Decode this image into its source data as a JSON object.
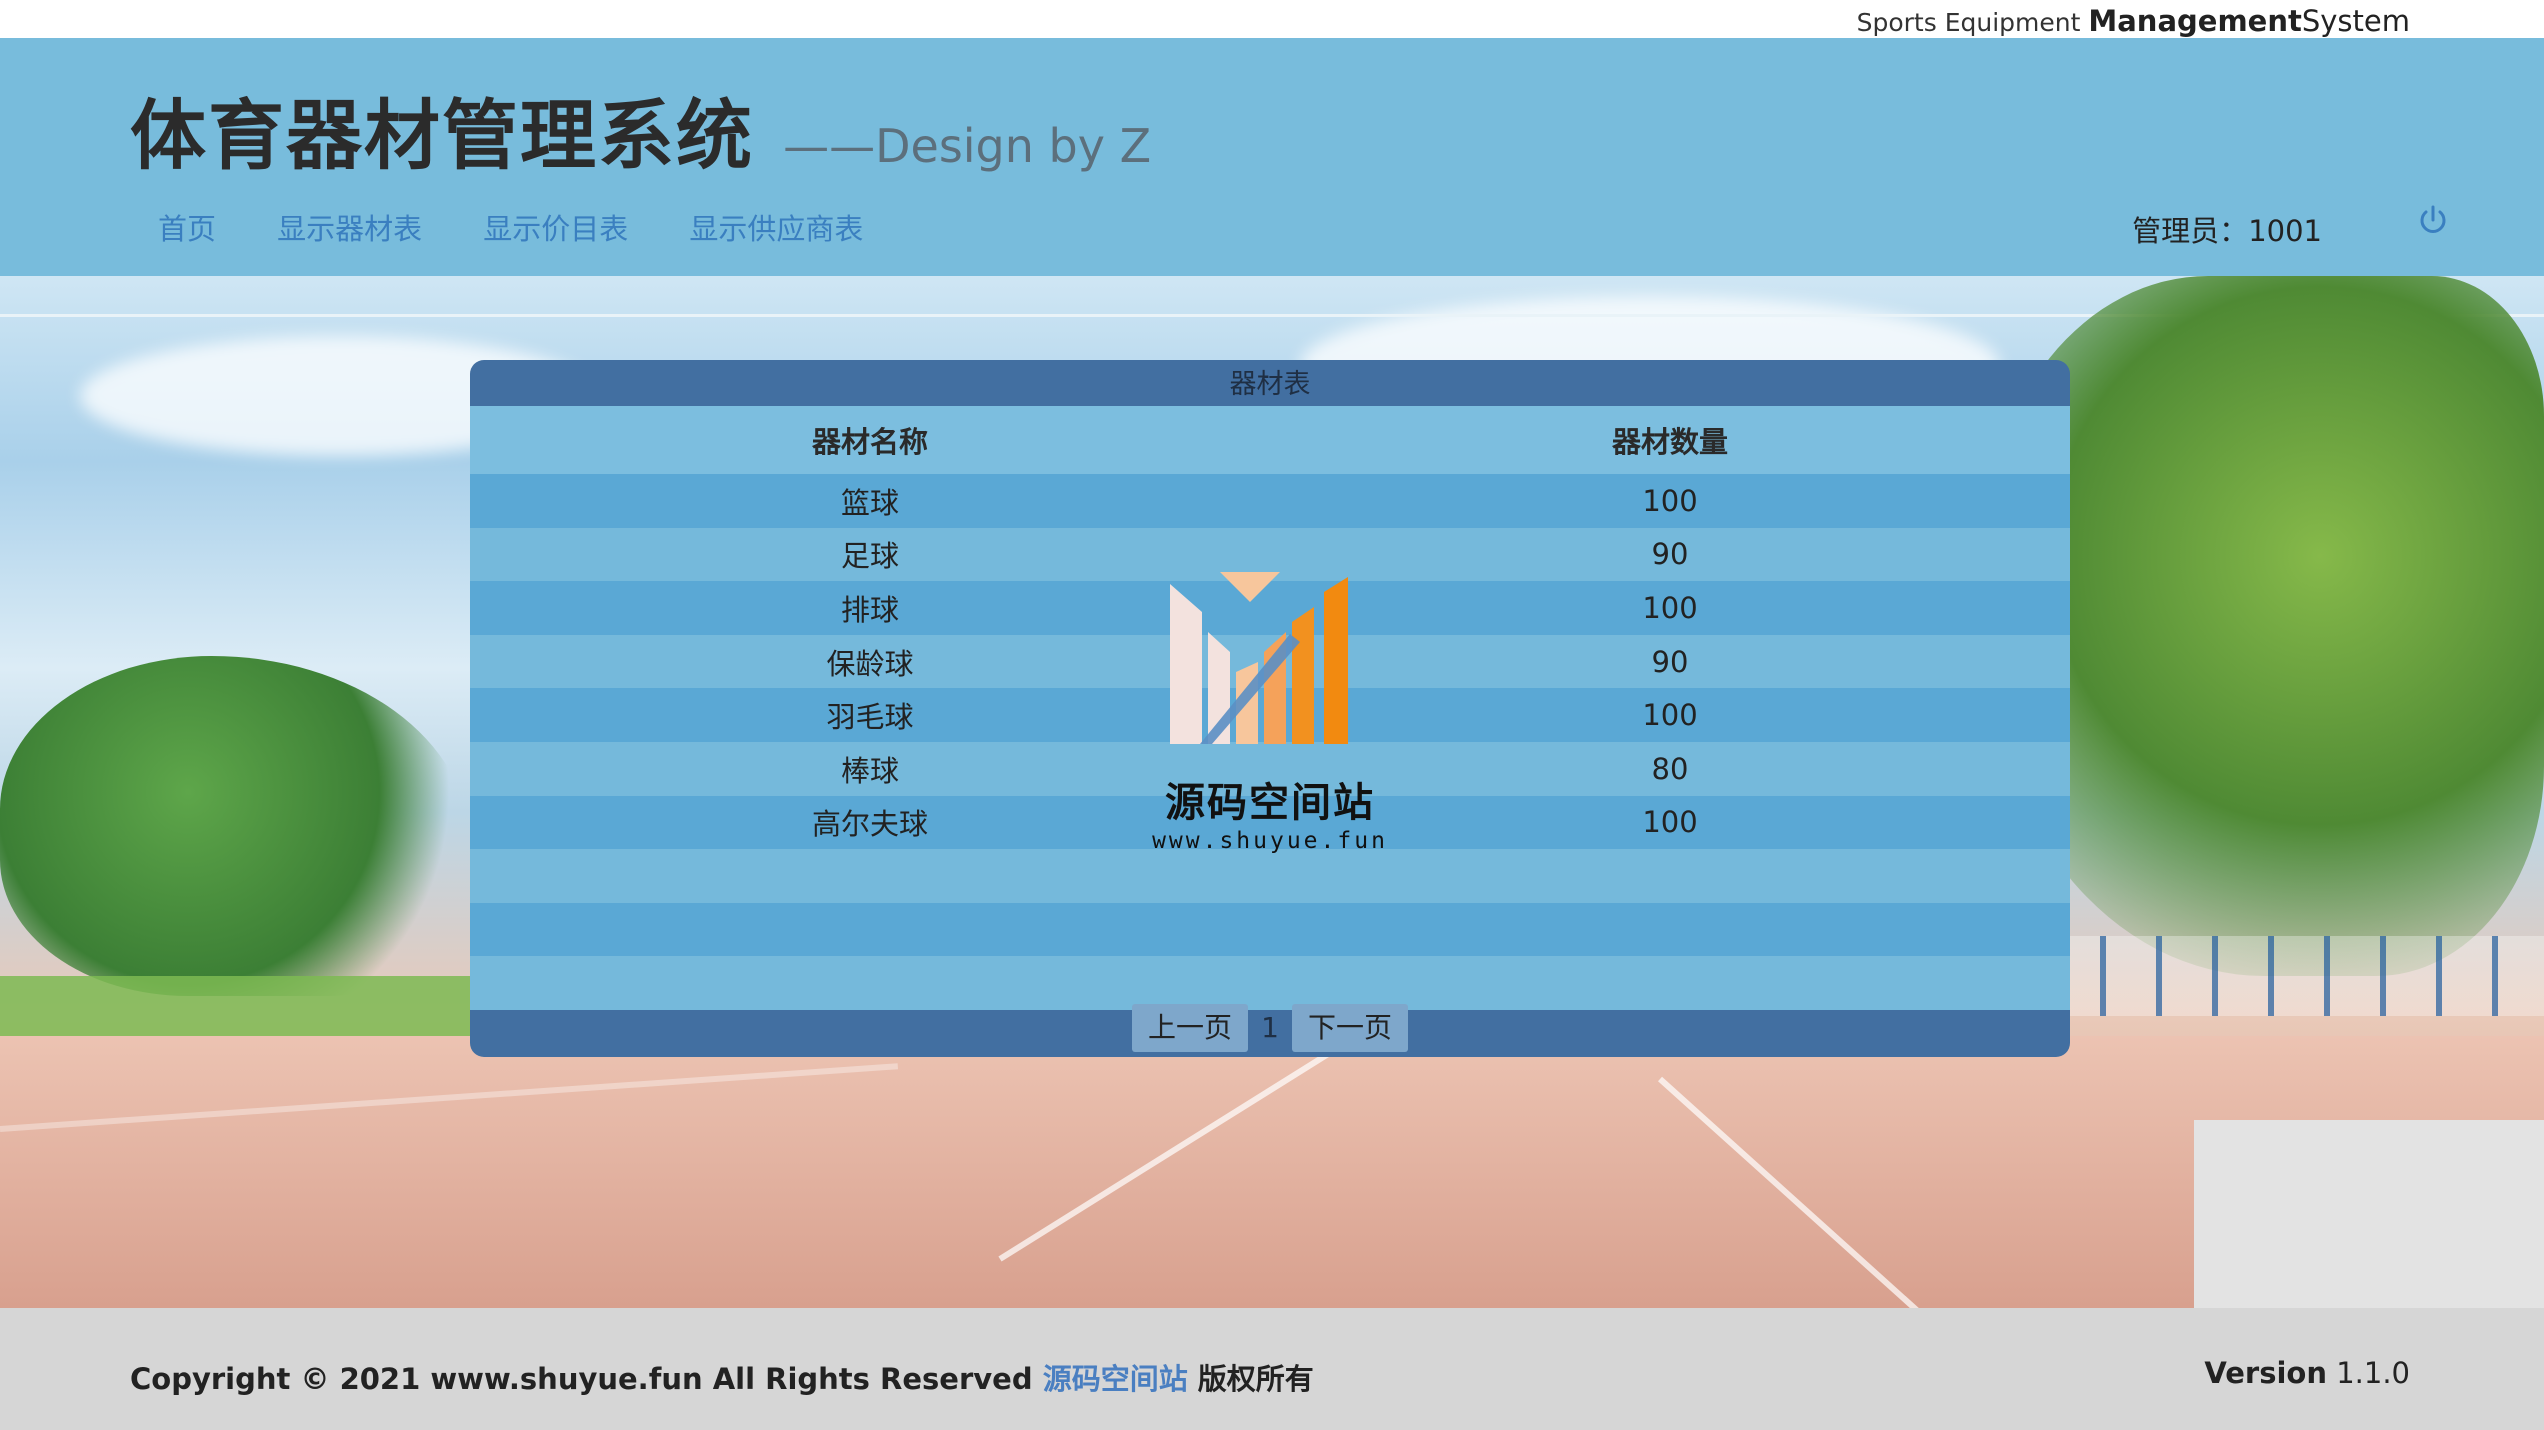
{
  "topbar": {
    "brand_prefix": "Sports Equipment ",
    "brand_bold": "Management",
    "brand_suffix": "System"
  },
  "header": {
    "title": "体育器材管理系统",
    "subtitle": "——Design by Z",
    "nav": [
      "首页",
      "显示器材表",
      "显示价目表",
      "显示供应商表"
    ],
    "admin_label": "管理员：",
    "admin_id": "1001",
    "power_icon": "power-icon"
  },
  "table": {
    "caption": "器材表",
    "columns": [
      "器材名称",
      "器材数量"
    ],
    "rows": [
      [
        "篮球",
        "100"
      ],
      [
        "足球",
        "90"
      ],
      [
        "排球",
        "100"
      ],
      [
        "保龄球",
        "90"
      ],
      [
        "羽毛球",
        "100"
      ],
      [
        "棒球",
        "80"
      ],
      [
        "高尔夫球",
        "100"
      ],
      [
        "",
        ""
      ],
      [
        "",
        ""
      ],
      [
        "",
        ""
      ]
    ],
    "pager": {
      "prev": "上一页",
      "page": "1",
      "next": "下一页"
    }
  },
  "watermark": {
    "title": "源码空间站",
    "url": "www.shuyue.fun"
  },
  "footer": {
    "copyright": "Copyright © 2021 www.shuyue.fun All Rights Reserved ",
    "link": "源码空间站",
    "suffix": " 版权所有",
    "version_label": "Version",
    "version_value": " 1.1.0"
  }
}
